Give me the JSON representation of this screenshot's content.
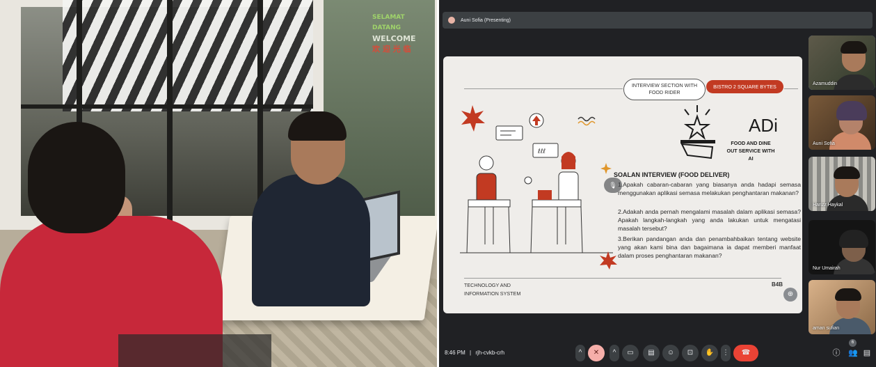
{
  "photo": {
    "sign_lines": [
      "SELAMAT DATANG",
      "WELCOME",
      "欢 迎 光 临"
    ]
  },
  "meet": {
    "presenter_label": "Auni Sofia (Presenting)",
    "slide": {
      "pill_interview": "INTERVIEW SECTION WITH FOOD RIDER",
      "pill_bistro": "BISTRO 2 SQUARE BYTES",
      "adi_title": "ADi",
      "adi_subtitle": "FOOD AND DINE OUT SERVICE WITH AI",
      "question_heading": "SOALAN INTERVIEW (FOOD DELIVER)",
      "questions": [
        "1.Apakah cabaran-cabaran yang biasanya anda hadapi semasa menggunakan aplikasi semasa melakukan penghantaran makanan?",
        "2.Adakah anda pernah mengalami masalah dalam aplikasi semasa? Apakah langkah-langkah yang anda lakukan untuk mengatasi masalah tersebut?",
        "3.Berikan pandangan anda dan penambahbaikan tentang website yang akan kami bina dan bagaimana ia dapat memberi manfaat dalam proses penghantaran makanan?"
      ],
      "tech_label": "TECHNOLOGY AND INFORMATION SYSTEM",
      "code_label": "B4B",
      "accent_color": "#c23a22"
    },
    "participants": [
      {
        "name": "Azamuddin",
        "icon": "person-tile"
      },
      {
        "name": "Auni Sofia",
        "icon": "person-tile"
      },
      {
        "name": "Harizz Haykal",
        "icon": "person-tile"
      },
      {
        "name": "Nur Umairah",
        "icon": "person-tile"
      },
      {
        "name": "aman sufian",
        "icon": "person-tile"
      }
    ],
    "bottom_bar": {
      "time": "8:46 PM",
      "separator": "|",
      "meeting_code": "rjh-cvkb-crh",
      "participant_count": "6"
    }
  }
}
